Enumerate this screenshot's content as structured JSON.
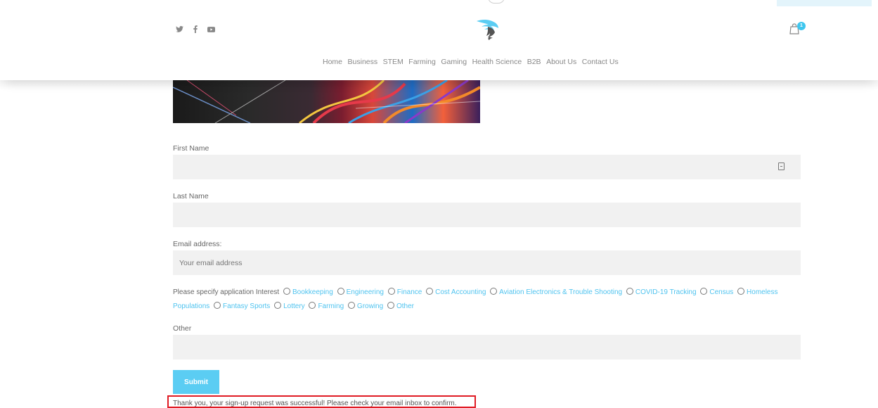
{
  "header": {
    "nav": [
      "Home",
      "Business",
      "STEM",
      "Farming",
      "Gaming",
      "Health Science",
      "B2B",
      "About Us",
      "Contact Us"
    ],
    "cart_count": "1",
    "social_icons": [
      "twitter-icon",
      "facebook-icon",
      "youtube-icon"
    ],
    "accent_color": "#3ec6ee"
  },
  "form": {
    "first_name_label": "First Name",
    "first_name_value": "",
    "last_name_label": "Last Name",
    "last_name_value": "",
    "email_label": "Email address:",
    "email_placeholder": "Your email address",
    "interest_label": "Please specify application Interest",
    "interest_options": [
      "Bookkeeping",
      "Engineering",
      "Finance",
      "Cost Accounting",
      "Aviation Electronics & Trouble Shooting",
      "COVID-19 Tracking",
      "Census",
      "Homeless Populations",
      "Fantasy Sports",
      "Lottery",
      "Farming",
      "Growing",
      "Other"
    ],
    "other_label": "Other",
    "other_value": "",
    "submit_label": "Submit",
    "success_message": "Thank you, your sign-up request was successful! Please check your email inbox to confirm."
  }
}
